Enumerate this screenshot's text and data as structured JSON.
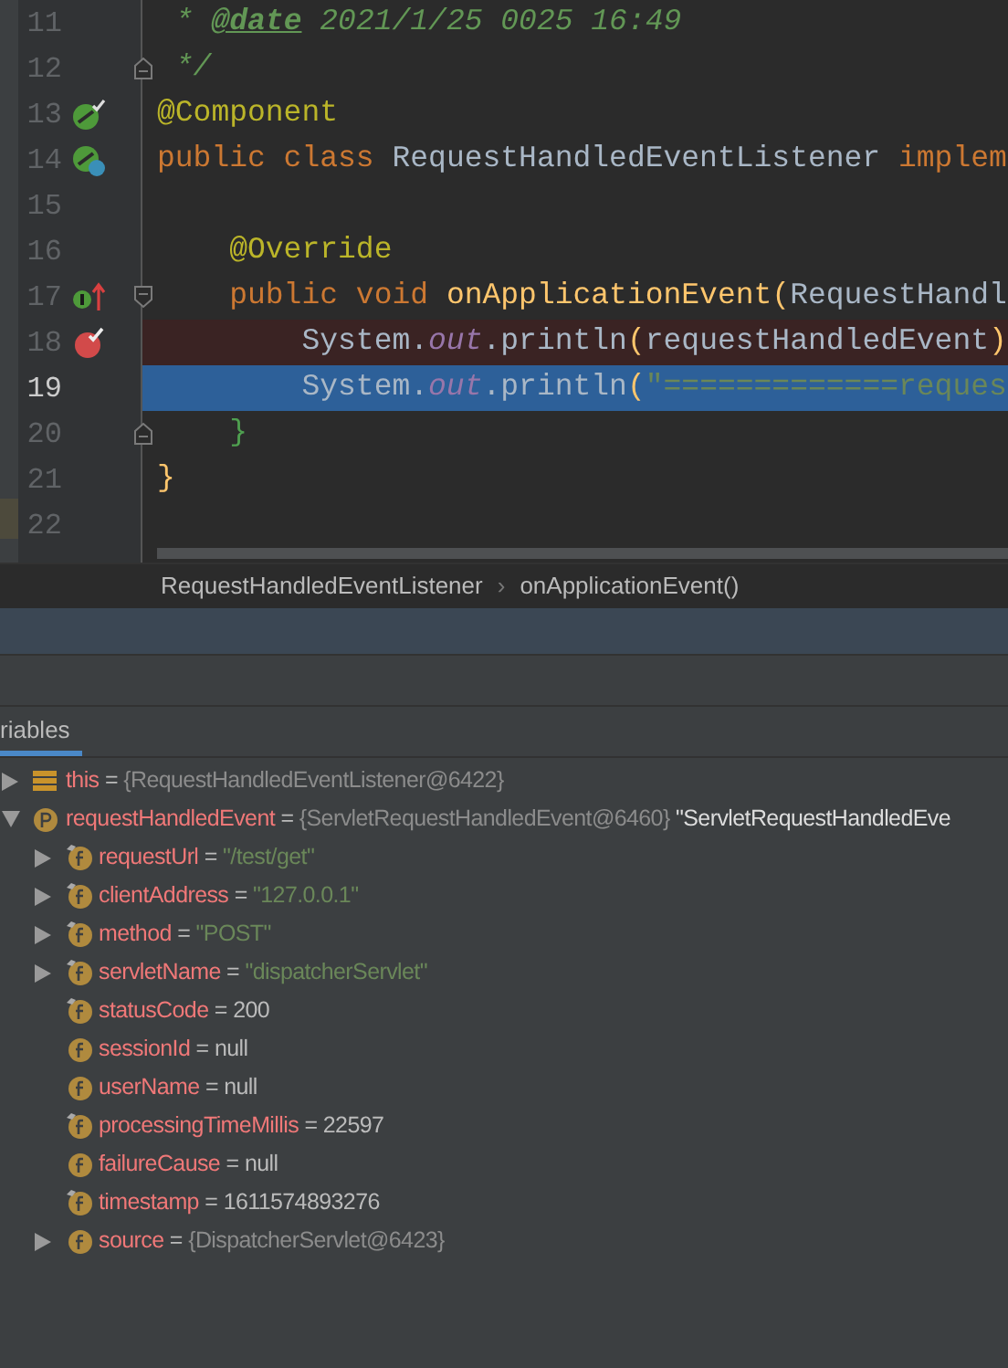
{
  "editor": {
    "lines": [
      {
        "number": "11",
        "tokens": [
          {
            "kind": "comment",
            "text": " * "
          },
          {
            "kind": "doc-tag",
            "text": "@date"
          },
          {
            "kind": "comment",
            "text": " 2021/1/25 0025 16:49"
          }
        ]
      },
      {
        "number": "12",
        "fold_end": true,
        "tokens": [
          {
            "kind": "comment",
            "text": " */"
          }
        ]
      },
      {
        "number": "13",
        "bean": true,
        "tokens": [
          {
            "kind": "annotation",
            "text": "@Component"
          }
        ]
      },
      {
        "number": "14",
        "bean_class": true,
        "tokens": [
          {
            "kind": "keyword",
            "text": "public class "
          },
          {
            "kind": "plain",
            "text": "RequestHandledEventListener "
          },
          {
            "kind": "keyword",
            "text": "implem"
          }
        ]
      },
      {
        "number": "15"
      },
      {
        "number": "16",
        "tokens": [
          {
            "kind": "annotation",
            "text": "    @Override"
          }
        ]
      },
      {
        "number": "17",
        "fold_start": true,
        "implements": true,
        "tokens": [
          {
            "kind": "keyword",
            "text": "    public void "
          },
          {
            "kind": "method",
            "text": "onApplicationEvent("
          },
          {
            "kind": "plain",
            "text": "RequestHandl"
          }
        ]
      },
      {
        "number": "18",
        "breakpoint": true,
        "tokens": [
          {
            "kind": "plain",
            "text": "        System."
          },
          {
            "kind": "static-field",
            "text": "out"
          },
          {
            "kind": "plain",
            "text": ".println"
          },
          {
            "kind": "method",
            "text": "("
          },
          {
            "kind": "plain",
            "text": "requestHandledEvent"
          },
          {
            "kind": "method",
            "text": ")"
          }
        ]
      },
      {
        "number": "19",
        "current": true,
        "tokens": [
          {
            "kind": "plain",
            "text": "        System."
          },
          {
            "kind": "static-field",
            "text": "out"
          },
          {
            "kind": "plain",
            "text": ".println"
          },
          {
            "kind": "method",
            "text": "("
          },
          {
            "kind": "string",
            "text": "\"=============reques"
          }
        ]
      },
      {
        "number": "20",
        "fold_end": true,
        "tokens": [
          {
            "kind": "brace",
            "text": "    }"
          }
        ]
      },
      {
        "number": "21",
        "tokens": [
          {
            "kind": "method",
            "text": "}"
          }
        ]
      },
      {
        "number": "22"
      }
    ]
  },
  "breadcrumbs": [
    "RequestHandledEventListener",
    "onApplicationEvent()"
  ],
  "breadcrumb_separator": "›",
  "debugger": {
    "tab": {
      "label": "riables",
      "selected": true
    },
    "separator": "=",
    "variables": [
      {
        "kind": "this",
        "expandable": true,
        "expanded": false,
        "name": "this",
        "reference": "{RequestHandledEventListener@6422}"
      },
      {
        "kind": "parameter",
        "expandable": true,
        "expanded": true,
        "name": "requestHandledEvent",
        "reference": "{ServletRequestHandledEvent@6460}",
        "summary": "\"ServletRequestHandledEve",
        "children": [
          {
            "kind": "field",
            "final": true,
            "expandable": true,
            "expanded": false,
            "name": "requestUrl",
            "string": "\"/test/get\""
          },
          {
            "kind": "field",
            "final": true,
            "expandable": true,
            "expanded": false,
            "name": "clientAddress",
            "string": "\"127.0.0.1\""
          },
          {
            "kind": "field",
            "final": true,
            "expandable": true,
            "expanded": false,
            "name": "method",
            "string": "\"POST\""
          },
          {
            "kind": "field",
            "final": true,
            "expandable": true,
            "expanded": false,
            "name": "servletName",
            "string": "\"dispatcherServlet\""
          },
          {
            "kind": "field",
            "final": true,
            "expandable": false,
            "name": "statusCode",
            "value": "200"
          },
          {
            "kind": "field",
            "final": false,
            "expandable": false,
            "name": "sessionId",
            "value": "null"
          },
          {
            "kind": "field",
            "final": false,
            "expandable": false,
            "name": "userName",
            "value": "null"
          },
          {
            "kind": "field",
            "final": true,
            "expandable": false,
            "name": "processingTimeMillis",
            "value": "22597"
          },
          {
            "kind": "field",
            "final": false,
            "expandable": false,
            "name": "failureCause",
            "value": "null"
          },
          {
            "kind": "field",
            "final": true,
            "expandable": false,
            "name": "timestamp",
            "value": "1611574893276"
          },
          {
            "kind": "field",
            "final": false,
            "expandable": true,
            "expanded": false,
            "name": "source",
            "reference": "{DispatcherServlet@6423}"
          }
        ]
      }
    ]
  }
}
